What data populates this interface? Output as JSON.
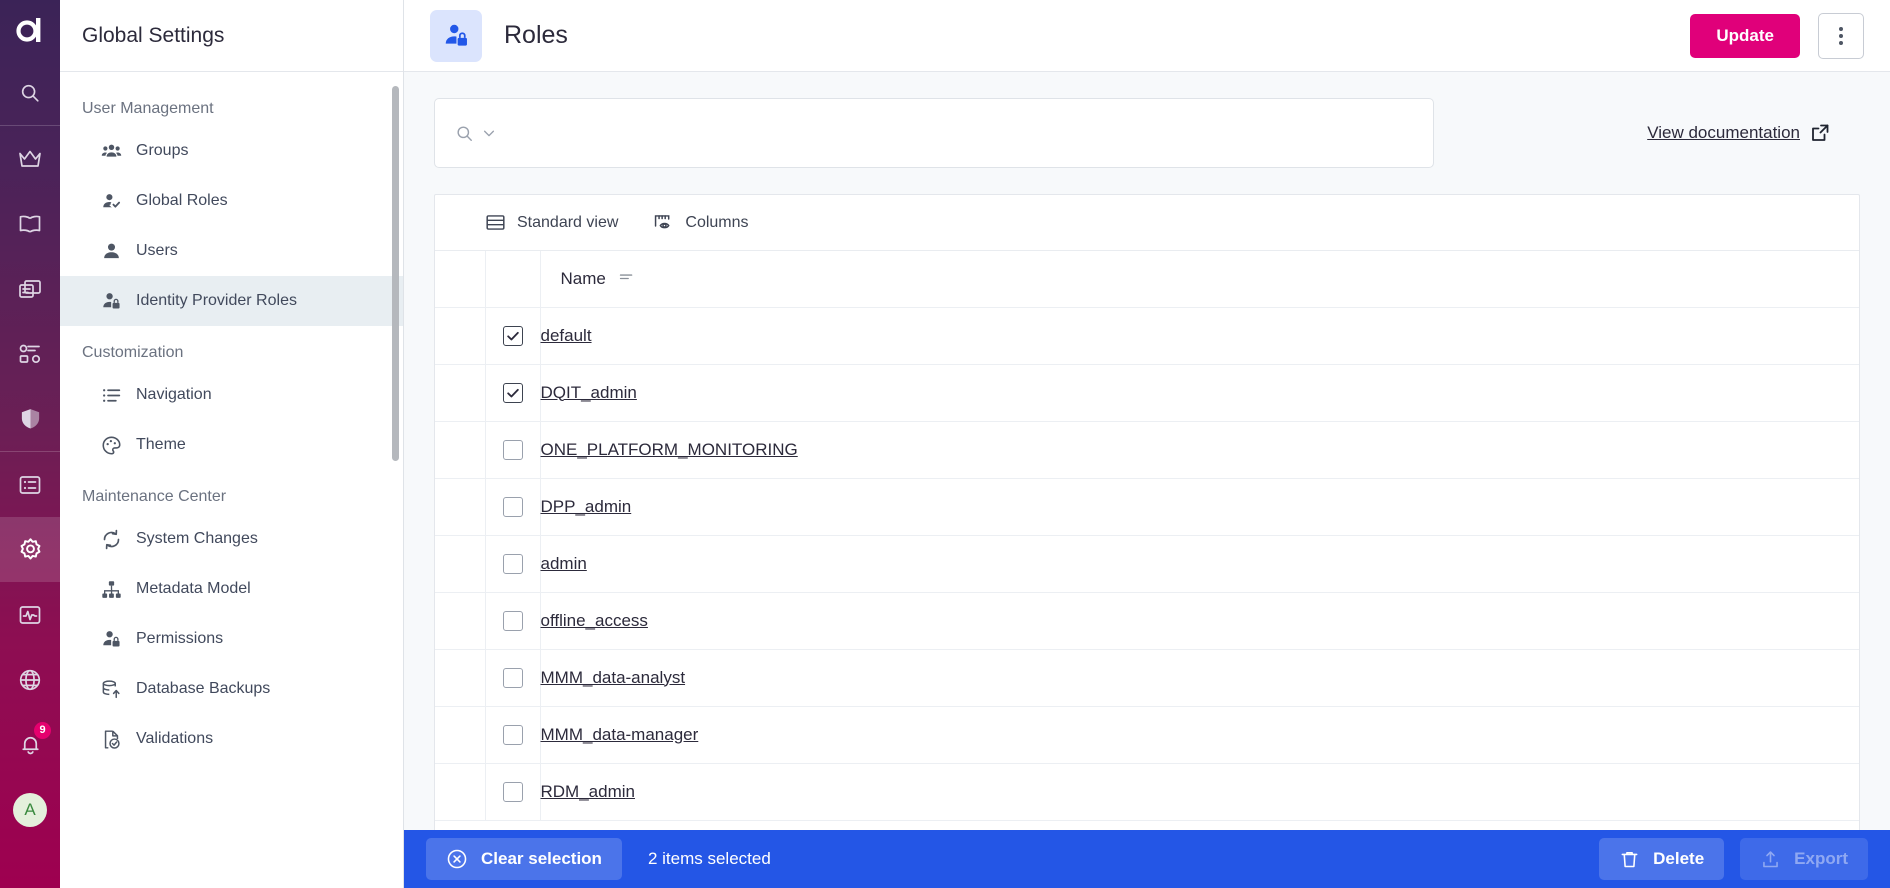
{
  "rail": {
    "logo": "aleph-logo",
    "items": [
      {
        "name": "search-icon",
        "label": "Search"
      },
      {
        "name": "crown-icon",
        "label": "Favorites"
      },
      {
        "name": "book-icon",
        "label": "Glossary"
      },
      {
        "name": "catalog-icon",
        "label": "Catalog"
      },
      {
        "name": "quality-icon",
        "label": "Data Quality"
      },
      {
        "name": "shield-icon",
        "label": "Governance"
      },
      {
        "name": "list-icon",
        "label": "Tasks"
      },
      {
        "name": "gear-icon",
        "label": "Settings"
      },
      {
        "name": "monitoring-icon",
        "label": "Monitoring"
      },
      {
        "name": "globe-icon",
        "label": "Language"
      },
      {
        "name": "bell-icon",
        "label": "Notifications"
      }
    ],
    "notification_count": "9",
    "avatar_initial": "A"
  },
  "sidebar": {
    "title": "Global Settings",
    "groups": [
      {
        "title": "User Management",
        "items": [
          {
            "label": "Groups",
            "icon": "groups-icon",
            "active": false
          },
          {
            "label": "Global Roles",
            "icon": "user-check-icon",
            "active": false
          },
          {
            "label": "Users",
            "icon": "user-icon",
            "active": false
          },
          {
            "label": "Identity Provider Roles",
            "icon": "user-lock-icon",
            "active": true
          }
        ]
      },
      {
        "title": "Customization",
        "items": [
          {
            "label": "Navigation",
            "icon": "bullet-list-icon",
            "active": false
          },
          {
            "label": "Theme",
            "icon": "palette-icon",
            "active": false
          }
        ]
      },
      {
        "title": "Maintenance Center",
        "items": [
          {
            "label": "System Changes",
            "icon": "sync-icon",
            "active": false
          },
          {
            "label": "Metadata Model",
            "icon": "hierarchy-icon",
            "active": false
          },
          {
            "label": "Permissions",
            "icon": "user-lock-icon",
            "active": false
          },
          {
            "label": "Database Backups",
            "icon": "database-upload-icon",
            "active": false
          },
          {
            "label": "Validations",
            "icon": "file-check-icon",
            "active": false
          }
        ]
      }
    ]
  },
  "header": {
    "icon": "user-lock-icon",
    "title": "Roles",
    "update_label": "Update",
    "kebab_label": "More actions"
  },
  "filters": {
    "search_placeholder": "",
    "search_value": "",
    "doc_link_label": "View documentation"
  },
  "table": {
    "toolbar": [
      {
        "label": "Standard view",
        "icon": "table-view-icon"
      },
      {
        "label": "Columns",
        "icon": "columns-eye-icon"
      }
    ],
    "columns": [
      "Name"
    ],
    "rows": [
      {
        "name": "default",
        "checked": true
      },
      {
        "name": "DQIT_admin",
        "checked": true
      },
      {
        "name": "ONE_PLATFORM_MONITORING",
        "checked": false
      },
      {
        "name": "DPP_admin",
        "checked": false
      },
      {
        "name": "admin",
        "checked": false
      },
      {
        "name": "offline_access",
        "checked": false
      },
      {
        "name": "MMM_data-analyst",
        "checked": false
      },
      {
        "name": "MMM_data-manager",
        "checked": false
      },
      {
        "name": "RDM_admin",
        "checked": false
      }
    ]
  },
  "selection_bar": {
    "clear_label": "Clear selection",
    "count_label": "2 items selected",
    "delete_label": "Delete",
    "export_label": "Export",
    "export_disabled": true
  },
  "colors": {
    "accent_pink": "#e0007a",
    "selection_blue": "#2456e6",
    "page_icon_blue": "#2257e8",
    "rail_top": "#3b2357",
    "rail_bottom": "#9e0050"
  }
}
